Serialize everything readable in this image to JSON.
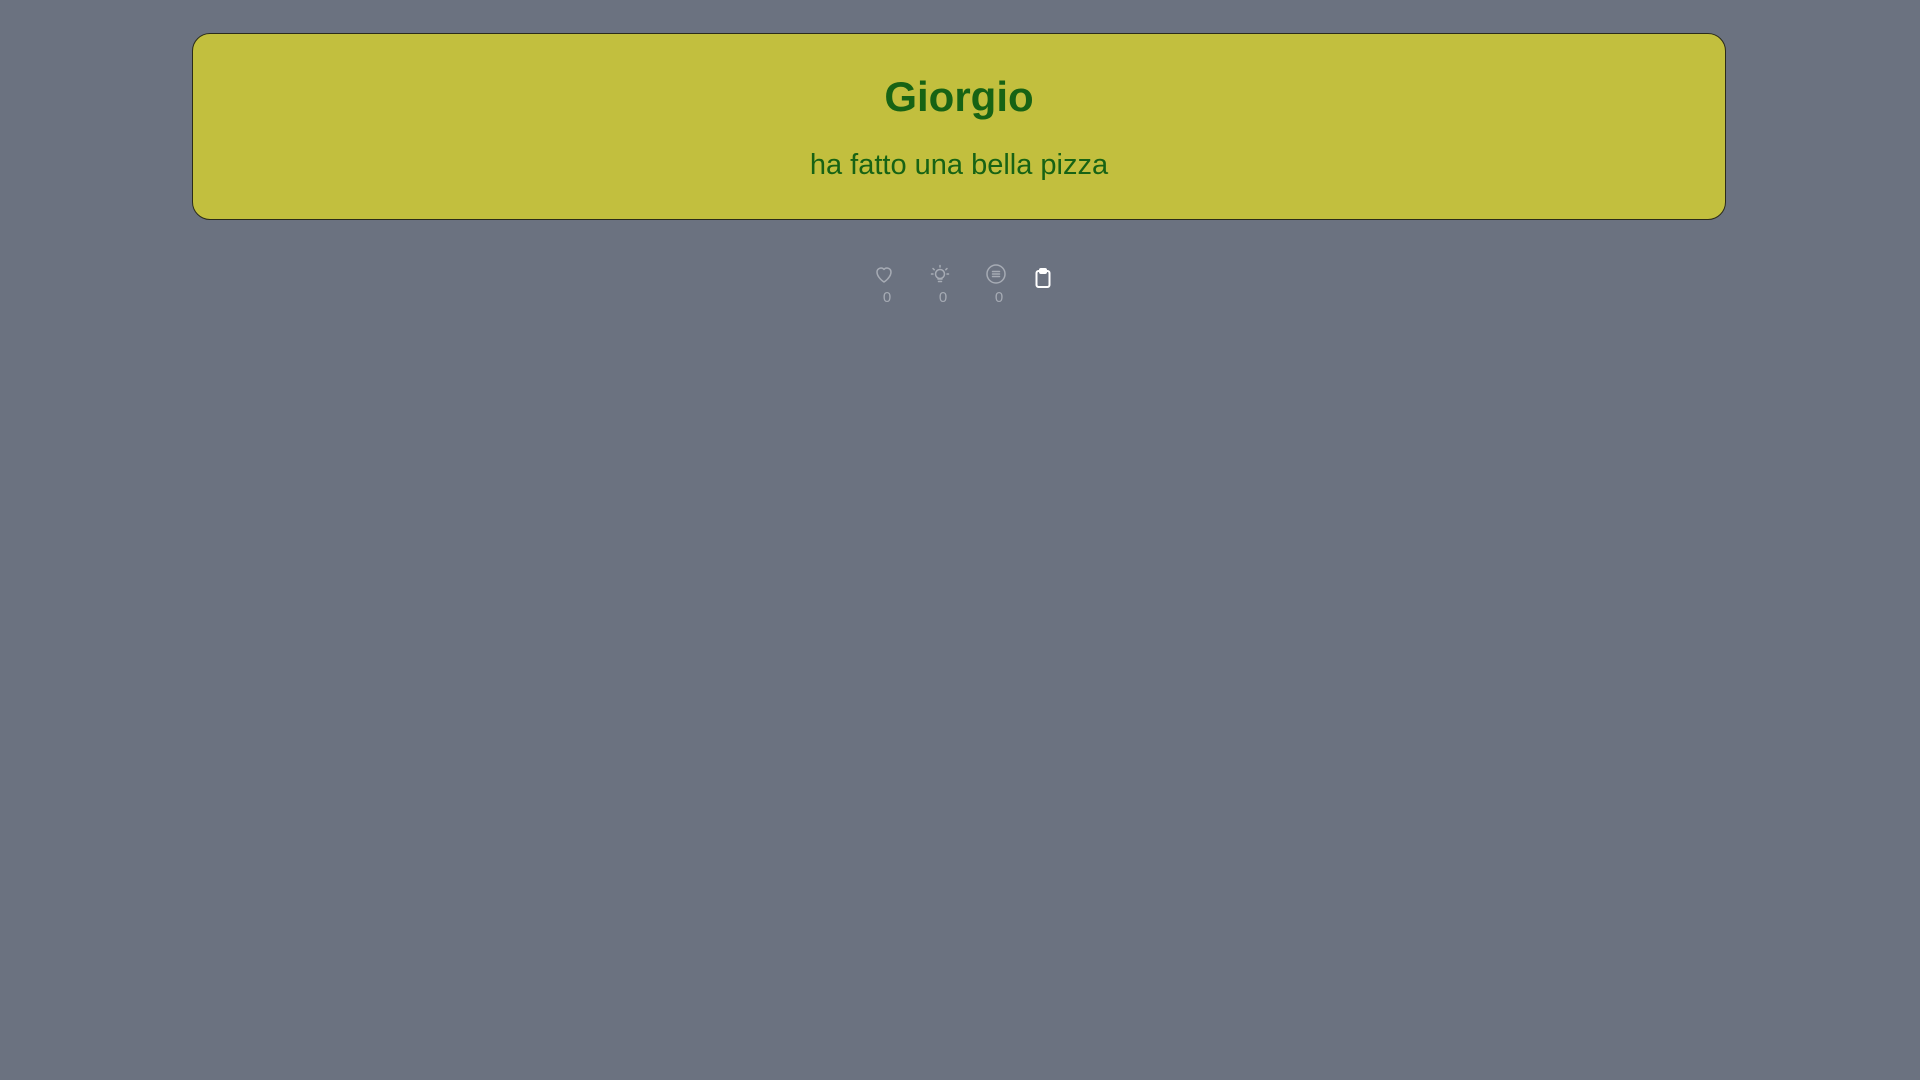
{
  "post": {
    "author": "Giorgio",
    "message": "ha fatto una bella pizza"
  },
  "reactions": {
    "like": {
      "icon": "heart-icon",
      "count": "0"
    },
    "idea": {
      "icon": "lightbulb-icon",
      "count": "0"
    },
    "comment": {
      "icon": "comment-icon",
      "count": "0"
    },
    "copy": {
      "icon": "clipboard-icon"
    }
  },
  "colors": {
    "background": "#6b7280",
    "card": "#c2bf3e",
    "text": "#176314",
    "icon": "#a6abb4",
    "clipboard": "#ffffff"
  }
}
